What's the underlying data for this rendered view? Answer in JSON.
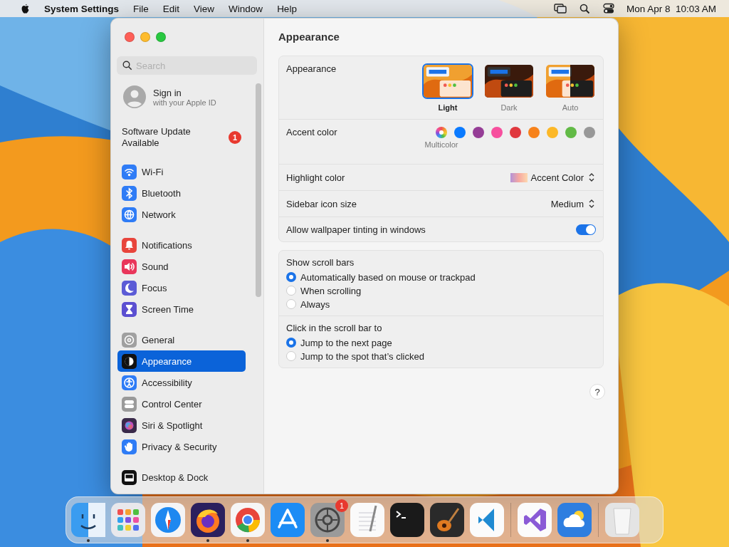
{
  "menu_bar": {
    "app_name": "System Settings",
    "menus": [
      "File",
      "Edit",
      "View",
      "Window",
      "Help"
    ],
    "clock": "Mon Apr 8  10:03 AM"
  },
  "sidebar": {
    "search": {
      "placeholder": "Search"
    },
    "account": {
      "title": "Sign in",
      "subtitle": "with your Apple ID"
    },
    "update": {
      "label": "Software Update Available",
      "badge": "1"
    },
    "groups": [
      [
        {
          "label": "Wi-Fi",
          "kind": "wifi",
          "selected": false
        },
        {
          "label": "Bluetooth",
          "kind": "bluetooth",
          "selected": false
        },
        {
          "label": "Network",
          "kind": "network",
          "selected": false
        }
      ],
      [
        {
          "label": "Notifications",
          "kind": "notifications",
          "selected": false
        },
        {
          "label": "Sound",
          "kind": "sound",
          "selected": false
        },
        {
          "label": "Focus",
          "kind": "focus",
          "selected": false
        },
        {
          "label": "Screen Time",
          "kind": "screentime",
          "selected": false
        }
      ],
      [
        {
          "label": "General",
          "kind": "general",
          "selected": false
        },
        {
          "label": "Appearance",
          "kind": "appearance",
          "selected": true
        },
        {
          "label": "Accessibility",
          "kind": "accessibility",
          "selected": false
        },
        {
          "label": "Control Center",
          "kind": "controlcenter",
          "selected": false
        },
        {
          "label": "Siri & Spotlight",
          "kind": "siri",
          "selected": false
        },
        {
          "label": "Privacy & Security",
          "kind": "privacy",
          "selected": false
        }
      ],
      [
        {
          "label": "Desktop & Dock",
          "kind": "desktop",
          "selected": false
        }
      ]
    ]
  },
  "content": {
    "title": "Appearance",
    "appearance": {
      "label": "Appearance",
      "options": [
        {
          "label": "Light",
          "kind": "light",
          "selected": true
        },
        {
          "label": "Dark",
          "kind": "dark",
          "selected": false
        },
        {
          "label": "Auto",
          "kind": "auto",
          "selected": false
        }
      ]
    },
    "accent": {
      "label": "Accent color",
      "colors": [
        {
          "kind": "multicolor",
          "label": "Multicolor",
          "selected": true
        },
        {
          "kind": "solid",
          "color": "#0a7aff",
          "selected": false
        },
        {
          "kind": "solid",
          "color": "#953d96",
          "selected": false
        },
        {
          "kind": "solid",
          "color": "#f74f9e",
          "selected": false
        },
        {
          "kind": "solid",
          "color": "#e0383e",
          "selected": false
        },
        {
          "kind": "solid",
          "color": "#f7821b",
          "selected": false
        },
        {
          "kind": "solid",
          "color": "#fcb827",
          "selected": false
        },
        {
          "kind": "solid",
          "color": "#62ba46",
          "selected": false
        },
        {
          "kind": "solid",
          "color": "#989898",
          "selected": false
        }
      ]
    },
    "highlight": {
      "label": "Highlight color",
      "value": "Accent Color"
    },
    "icon_size": {
      "label": "Sidebar icon size",
      "value": "Medium"
    },
    "tinting": {
      "label": "Allow wallpaper tinting in windows",
      "on": true
    },
    "scroll_groups": [
      {
        "title": "Show scroll bars",
        "options": [
          {
            "label": "Automatically based on mouse or trackpad",
            "selected": true
          },
          {
            "label": "When scrolling",
            "selected": false
          },
          {
            "label": "Always",
            "selected": false
          }
        ]
      },
      {
        "title": "Click in the scroll bar to",
        "options": [
          {
            "label": "Jump to the next page",
            "selected": true
          },
          {
            "label": "Jump to the spot that’s clicked",
            "selected": false
          }
        ]
      }
    ],
    "help": "?"
  },
  "dock": {
    "sections": [
      [
        {
          "kind": "finder",
          "running": true
        },
        {
          "kind": "launchpad",
          "running": false
        },
        {
          "kind": "safari",
          "running": false
        },
        {
          "kind": "firefox",
          "running": true
        },
        {
          "kind": "chrome",
          "running": true
        },
        {
          "kind": "appstore",
          "running": false
        },
        {
          "kind": "settings",
          "running": true,
          "badge": "1"
        },
        {
          "kind": "textedit",
          "running": false
        },
        {
          "kind": "terminal",
          "running": false
        },
        {
          "kind": "garageband",
          "running": false
        },
        {
          "kind": "vscode",
          "running": false
        }
      ],
      [
        {
          "kind": "visualstudio",
          "running": false
        },
        {
          "kind": "weather",
          "running": false
        }
      ],
      [
        {
          "kind": "trash",
          "running": false
        }
      ]
    ]
  }
}
